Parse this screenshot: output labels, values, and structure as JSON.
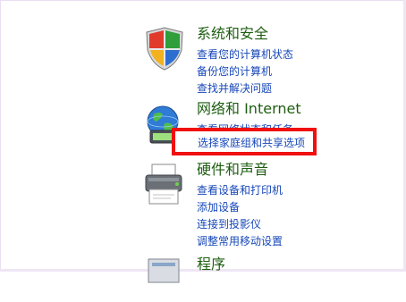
{
  "categories": [
    {
      "title": "系统和安全",
      "icon": "shield-icon",
      "links": [
        "查看您的计算机状态",
        "备份您的计算机",
        "查找并解决问题"
      ]
    },
    {
      "title": "网络和 Internet",
      "icon": "globe-network-icon",
      "links": [
        "查看网络状态和任务",
        "选择家庭组和共享选项"
      ]
    },
    {
      "title": "硬件和声音",
      "icon": "printer-icon",
      "links": [
        "查看设备和打印机",
        "添加设备",
        "连接到投影仪",
        "调整常用移动设置"
      ]
    },
    {
      "title": "程序",
      "icon": "programs-icon",
      "links": []
    }
  ],
  "highlight_color": "#f01010",
  "title_color": "#1e5e11",
  "link_color": "#1747b8"
}
